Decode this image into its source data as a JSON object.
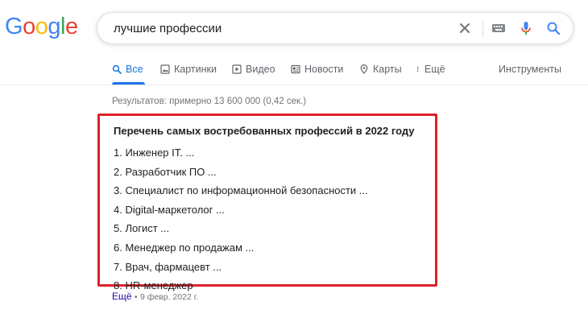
{
  "logo": {
    "letters": [
      "G",
      "o",
      "o",
      "g",
      "l",
      "e"
    ],
    "colors": [
      "#4285f4",
      "#ea4335",
      "#fbbc05",
      "#4285f4",
      "#34a853",
      "#ea4335"
    ]
  },
  "search": {
    "query": "лучшие профессии",
    "icons": [
      "close-icon",
      "keyboard-icon",
      "microphone-icon",
      "search-icon"
    ]
  },
  "tabs": [
    {
      "label": "Все",
      "icon": "search-icon",
      "active": true
    },
    {
      "label": "Картинки",
      "icon": "image-icon",
      "active": false
    },
    {
      "label": "Видео",
      "icon": "video-icon",
      "active": false
    },
    {
      "label": "Новости",
      "icon": "news-icon",
      "active": false
    },
    {
      "label": "Карты",
      "icon": "map-pin-icon",
      "active": false
    },
    {
      "label": "Ещё",
      "icon": "more-vertical-icon",
      "active": false
    }
  ],
  "tools_label": "Инструменты",
  "result_stats": "Результатов: примерно 13 600 000 (0,42 сек.)",
  "snippet": {
    "title": "Перечень самых востребованных профессий в 2022 году",
    "items": [
      "1. Инженер IT. ...",
      "2. Разработчик ПО ...",
      "3. Специалист по информационной безопасности ...",
      "4. Digital-маркетолог ...",
      "5. Логист ...",
      "6. Менеджер по продажам ...",
      "7. Врач, фармацевт ...",
      "8. HR-менеджер"
    ],
    "highlight_color": "#e0212a"
  },
  "more": {
    "label": "Ещё",
    "separator": "•",
    "date": "9 февр. 2022 г."
  },
  "colors": {
    "accent": "#1a73e8",
    "link": "#1a0dab",
    "muted": "#70757a"
  }
}
